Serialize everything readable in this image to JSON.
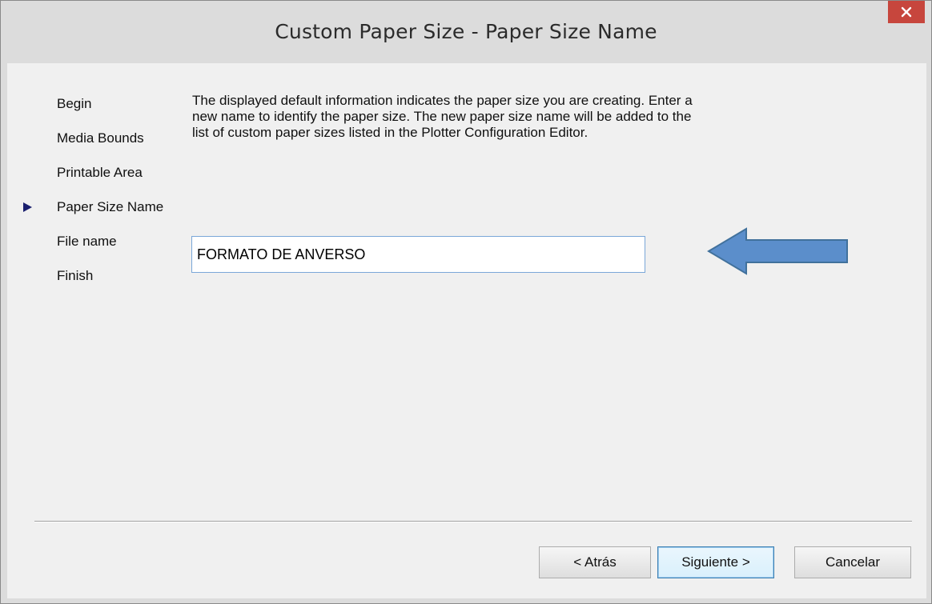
{
  "window": {
    "title": "Custom Paper Size - Paper Size Name",
    "close_glyph": "✕"
  },
  "steps": [
    {
      "label": "Begin",
      "current": false
    },
    {
      "label": "Media Bounds",
      "current": false
    },
    {
      "label": "Printable Area",
      "current": false
    },
    {
      "label": "Paper Size Name",
      "current": true
    },
    {
      "label": "File name",
      "current": false
    },
    {
      "label": "Finish",
      "current": false
    }
  ],
  "description": "The displayed default information indicates the paper size you are creating. Enter a new name to identify the paper size. The new paper size name will be added to the list of custom paper sizes listed in the Plotter Configuration Editor.",
  "paper_name_input": {
    "value": "FORMATO DE ANVERSO"
  },
  "buttons": {
    "back": "< Atrás",
    "next": "Siguiente >",
    "cancel": "Cancelar"
  },
  "colors": {
    "close_button": "#c7463d",
    "annotation_arrow": "#5b8ecb",
    "step_marker": "#1a1f6e"
  },
  "icons": {
    "close": "close-icon",
    "step_marker": "current-step-triangle-icon",
    "annotation": "left-arrow-annotation-icon"
  }
}
